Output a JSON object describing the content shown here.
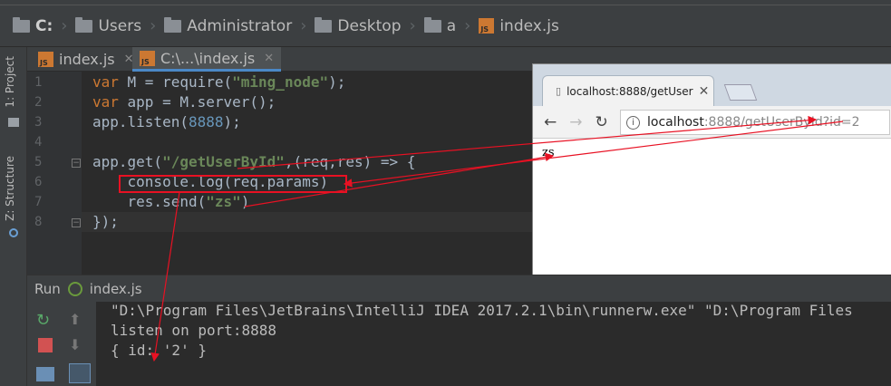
{
  "breadcrumb": {
    "items": [
      {
        "label": "C:"
      },
      {
        "label": "Users"
      },
      {
        "label": "Administrator"
      },
      {
        "label": "Desktop"
      },
      {
        "label": "a"
      },
      {
        "label": "index.js"
      }
    ]
  },
  "sidebar": {
    "project_tab": "1: Project",
    "structure_tab": "Z: Structure"
  },
  "editor": {
    "tabs": [
      {
        "label": "index.js"
      },
      {
        "label": "C:\\...\\index.js"
      }
    ],
    "line_numbers": [
      "1",
      "2",
      "3",
      "4",
      "5",
      "6",
      "7",
      "8"
    ],
    "code": {
      "l1_kw": "var",
      "l1_a": " M = require(",
      "l1_s": "\"ming_node\"",
      "l1_b": ");",
      "l2_kw": "var",
      "l2_a": " app = M.server();",
      "l3_a": "app.listen(",
      "l3_n": "8888",
      "l3_b": ");",
      "l5_a": "app.get(",
      "l5_s": "\"/getUserById\"",
      "l5_b": ",(req,res) => {",
      "l6": "    console.log(req.params)",
      "l7_a": "    res.send(",
      "l7_s": "\"zs\"",
      "l7_b": ")",
      "l8": "});"
    }
  },
  "browser": {
    "tab_title": "localhost:8888/getUser",
    "url_host": "localhost",
    "url_path": ":8888/getUserById?id=2",
    "response": "zs"
  },
  "run": {
    "label": "Run",
    "file": "index.js",
    "console_lines": [
      "\"D:\\Program Files\\JetBrains\\IntelliJ IDEA 2017.2.1\\bin\\runnerw.exe\" \"D:\\Program Files",
      "listen on port:8888",
      "{ id: '2' }"
    ]
  },
  "colors": {
    "annotation": "#e81123",
    "keyword": "#cc7832",
    "string": "#6a8759",
    "number": "#6897bb"
  }
}
